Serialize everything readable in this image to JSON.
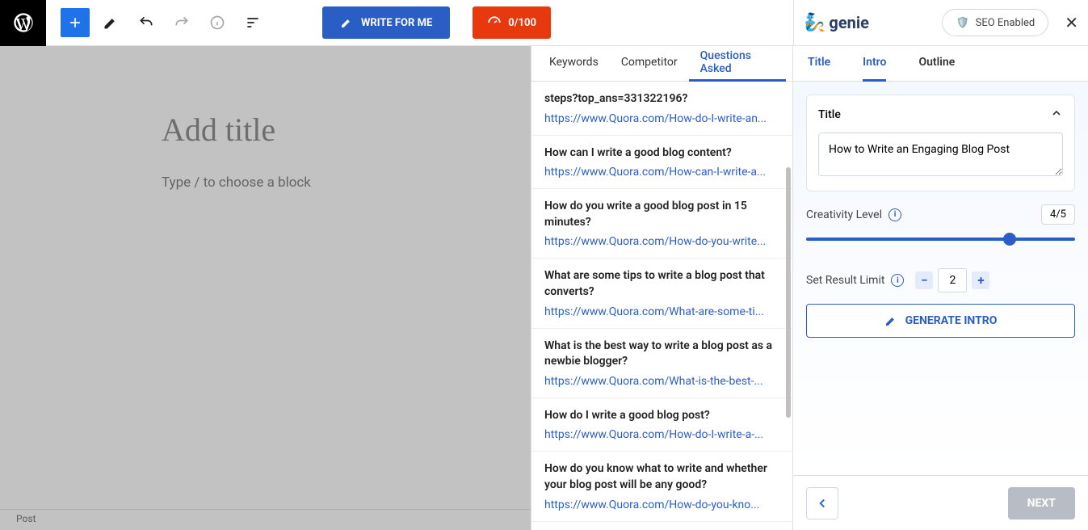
{
  "toolbar": {
    "write_label": "WRITE FOR ME",
    "score_label": "0/100"
  },
  "editor": {
    "title_placeholder": "Add title",
    "block_hint": "Type / to choose a block",
    "footer_label": "Post"
  },
  "mid": {
    "tabs": [
      "Keywords",
      "Competitor",
      "Questions Asked"
    ],
    "active_tab": 2,
    "questions": [
      {
        "text": "steps?top_ans=331322196?",
        "url": "https://www.Quora.com/How-do-I-write-an..."
      },
      {
        "text": "How can I write a good blog content?",
        "url": "https://www.Quora.com/How-can-I-write-a..."
      },
      {
        "text": "How do you write a good blog post in 15 minutes?",
        "url": "https://www.Quora.com/How-do-you-write..."
      },
      {
        "text": "What are some tips to write a blog post that converts?",
        "url": "https://www.Quora.com/What-are-some-ti..."
      },
      {
        "text": "What is the best way to write a blog post as a newbie blogger?",
        "url": "https://www.Quora.com/What-is-the-best-..."
      },
      {
        "text": "How do I write a good blog post?",
        "url": "https://www.Quora.com/How-do-I-write-a-..."
      },
      {
        "text": "How do you know what to write and whether your blog post will be any good?",
        "url": "https://www.Quora.com/How-do-you-kno..."
      }
    ]
  },
  "right": {
    "brand": "genie",
    "seo_label": "SEO Enabled",
    "tabs": [
      "Title",
      "Intro",
      "Outline"
    ],
    "title_card_label": "Title",
    "title_value": "How to Write an Engaging Blog Post",
    "creativity_label": "Creativity Level",
    "creativity_value": "4/5",
    "result_limit_label": "Set Result Limit",
    "result_limit_value": "2",
    "generate_label": "GENERATE INTRO",
    "next_label": "NEXT"
  }
}
